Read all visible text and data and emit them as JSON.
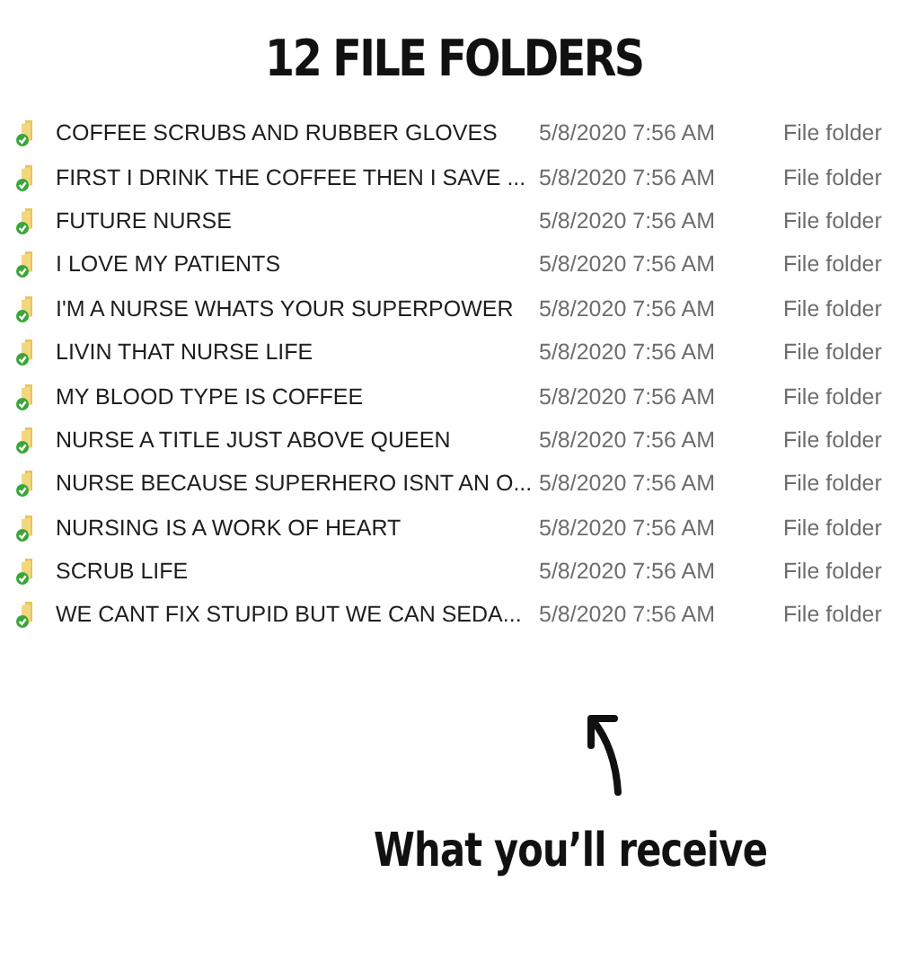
{
  "title": "12 FILE FOLDERS",
  "folders": [
    {
      "name": "COFFEE SCRUBS AND RUBBER GLOVES",
      "date": "5/8/2020 7:56 AM",
      "type": "File folder"
    },
    {
      "name": "FIRST I DRINK THE COFFEE THEN I SAVE ...",
      "date": "5/8/2020 7:56 AM",
      "type": "File folder"
    },
    {
      "name": "FUTURE NURSE",
      "date": "5/8/2020 7:56 AM",
      "type": "File folder"
    },
    {
      "name": "I LOVE MY PATIENTS",
      "date": "5/8/2020 7:56 AM",
      "type": "File folder"
    },
    {
      "name": "I'M A NURSE WHATS YOUR SUPERPOWER",
      "date": "5/8/2020 7:56 AM",
      "type": "File folder"
    },
    {
      "name": "LIVIN THAT NURSE LIFE",
      "date": "5/8/2020 7:56 AM",
      "type": "File folder"
    },
    {
      "name": "MY BLOOD TYPE IS COFFEE",
      "date": "5/8/2020 7:56 AM",
      "type": "File folder"
    },
    {
      "name": "NURSE A TITLE JUST ABOVE QUEEN",
      "date": "5/8/2020 7:56 AM",
      "type": "File folder"
    },
    {
      "name": "NURSE BECAUSE SUPERHERO ISNT AN O...",
      "date": "5/8/2020 7:56 AM",
      "type": "File folder"
    },
    {
      "name": "NURSING IS A WORK OF HEART",
      "date": "5/8/2020 7:56 AM",
      "type": "File folder"
    },
    {
      "name": "SCRUB LIFE",
      "date": "5/8/2020 7:56 AM",
      "type": "File folder"
    },
    {
      "name": "WE CANT FIX STUPID BUT WE CAN SEDA...",
      "date": "5/8/2020 7:56 AM",
      "type": "File folder"
    }
  ],
  "caption": "What you’ll receive"
}
